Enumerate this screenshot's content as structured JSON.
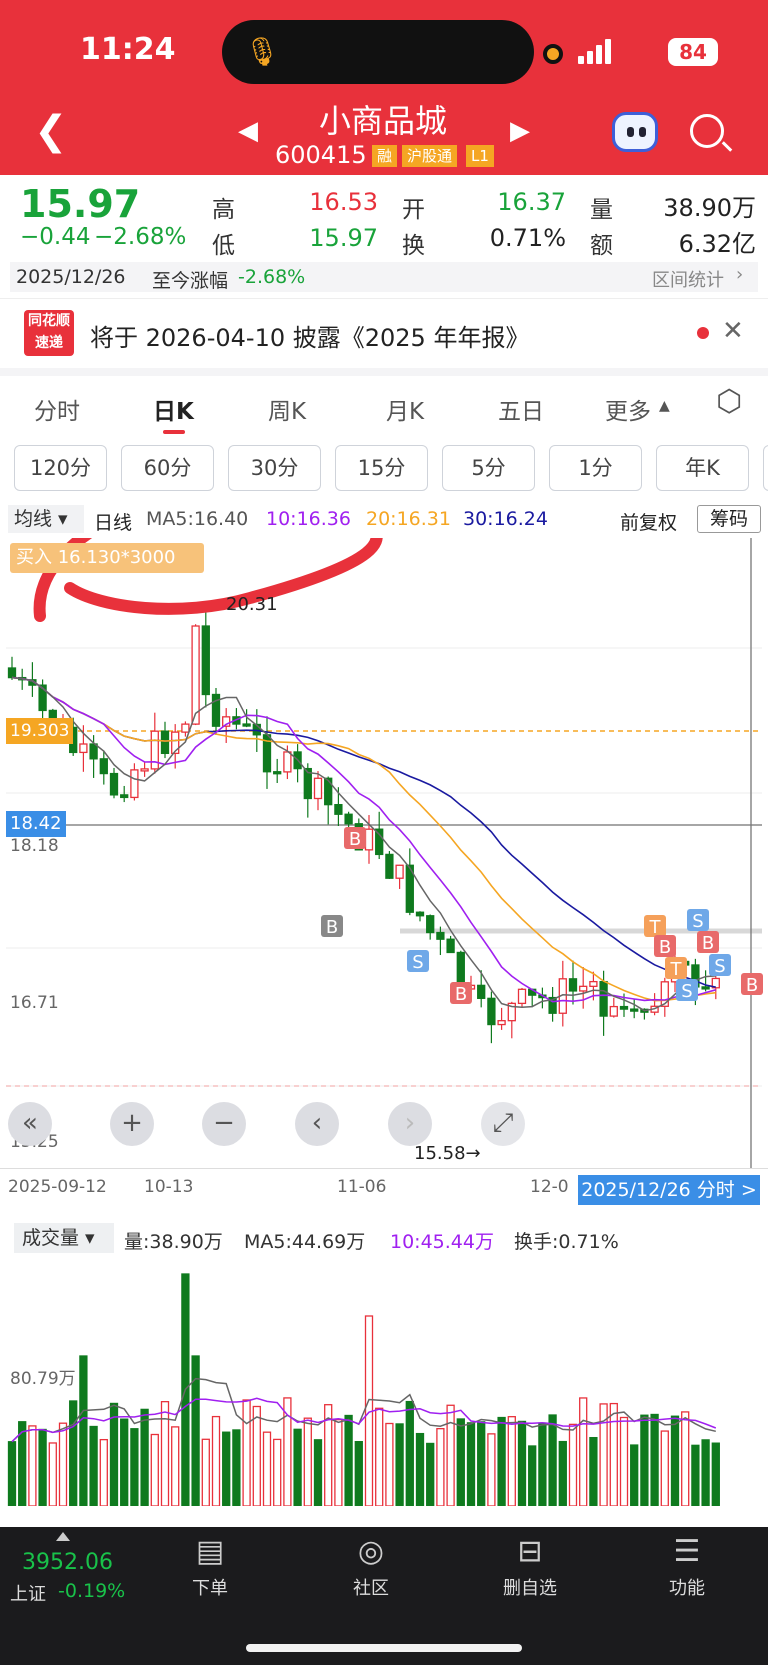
{
  "status": {
    "time": "11:24",
    "battery": "84"
  },
  "header": {
    "title": "小商品城",
    "code": "600415",
    "badges": [
      "融",
      "沪股通",
      "L1"
    ]
  },
  "quote": {
    "price": "15.97",
    "change": "−0.44",
    "change_pct": "−2.68%",
    "high_label": "高",
    "high": "16.53",
    "low_label": "低",
    "low": "15.97",
    "open_label": "开",
    "open": "16.37",
    "turnover_label": "换",
    "turnover": "0.71%",
    "volume_label": "量",
    "volume": "38.90万",
    "amount_label": "额",
    "amount": "6.32亿",
    "date": "2025/12/26",
    "since_label": "至今涨幅",
    "since_value": "-2.68%",
    "range_stats": "区间统计"
  },
  "notice": {
    "logo_top": "同花顺",
    "logo_bottom": "速递",
    "text": "将于 2026-04-10 披露《2025 年年报》"
  },
  "tabs": [
    "分时",
    "日K",
    "周K",
    "月K",
    "五日",
    "更多"
  ],
  "periods": [
    "120分",
    "60分",
    "30分",
    "15分",
    "5分",
    "1分",
    "年K"
  ],
  "ma_legend": {
    "dropdown": "均线",
    "type": "日线",
    "ma5": "MA5:16.40",
    "ma10": "10:16.36",
    "ma20": "20:16.31",
    "ma30": "30:16.24",
    "adjust": "前复权",
    "chouma": "筹码"
  },
  "kline": {
    "buy_tag": "买入 16.130*3000",
    "high_mark": "20.31",
    "low_mark": "15.58→",
    "orange_line": "19.303",
    "cursor_price": "18.42",
    "axis": [
      "18.18",
      "16.71",
      "15.25"
    ],
    "x_labels": [
      "2025-09-12",
      "10-13",
      "11-06",
      "12-0"
    ],
    "date_button": "2025/12/26 分时 >"
  },
  "volume": {
    "dropdown": "成交量",
    "vol": "量:38.90万",
    "ma5": "MA5:44.69万",
    "ma10": "10:45.44万",
    "turnover": "换手:0.71%",
    "axis": "80.79万"
  },
  "bottom": {
    "index_value": "3952.06",
    "index_name": "上证",
    "index_chg": "-0.19%",
    "nav": [
      {
        "label": "下单",
        "icon": "order-icon"
      },
      {
        "label": "社区",
        "icon": "community-icon"
      },
      {
        "label": "删自选",
        "icon": "remove-watchlist-icon"
      },
      {
        "label": "功能",
        "icon": "menu-icon"
      }
    ]
  },
  "colors": {
    "header_red": "#e8313b",
    "down_green": "#19a33a",
    "up_red": "#e8313b",
    "ma5": "#666666",
    "ma10": "#a020f0",
    "ma20": "#f5a623",
    "ma30": "#1a1aa0"
  }
}
